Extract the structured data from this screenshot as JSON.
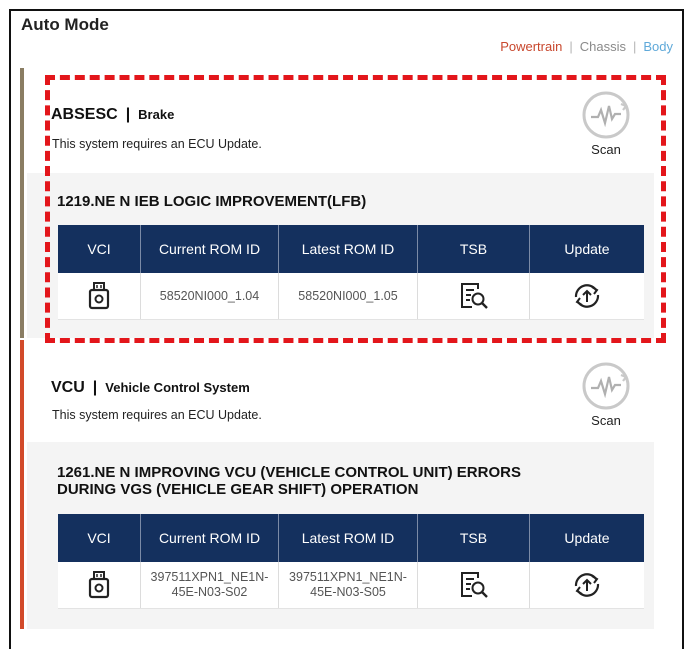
{
  "page": {
    "title": "Auto Mode"
  },
  "tabs": [
    {
      "label": "Powertrain",
      "color": "#c8472d"
    },
    {
      "label": "Chassis",
      "color": "#8a8a8a"
    },
    {
      "label": "Body",
      "color": "#5fa9d9"
    }
  ],
  "table_headers": [
    "VCI",
    "Current ROM ID",
    "Latest ROM ID",
    "TSB",
    "Update"
  ],
  "systems": [
    {
      "name": "ABSESC",
      "subtitle": "Brake",
      "message": "This system requires an ECU Update.",
      "scan_label": "Scan",
      "update_title_line1": "1219.NE N IEB LOGIC IMPROVEMENT(LFB)",
      "update_title_line2": "",
      "current_rom_id": "58520NI000_1.04",
      "latest_rom_id": "58520NI000_1.05"
    },
    {
      "name": "VCU",
      "subtitle": "Vehicle Control System",
      "message": "This system requires an ECU Update.",
      "scan_label": "Scan",
      "update_title_line1": "1261.NE N IMPROVING VCU (VEHICLE CONTROL UNIT) ERRORS",
      "update_title_line2": "DURING VGS (VEHICLE GEAR SHIFT) OPERATION",
      "current_rom_id": "397511XPN1_NE1N-45E-N03-S02",
      "latest_rom_id": "397511XPN1_NE1N-45E-N03-S05"
    }
  ],
  "icons": {
    "scan": "scan-waveform-icon",
    "vci": "vci-device-icon",
    "tsb": "tsb-document-search-icon",
    "update": "update-refresh-icon"
  },
  "colors": {
    "header_bg": "#14305e",
    "latest_rom": "#2aa8c8",
    "highlight_dash": "#e3161b",
    "card1_accent": "#8a7d63",
    "card2_accent": "#d24a2a"
  }
}
